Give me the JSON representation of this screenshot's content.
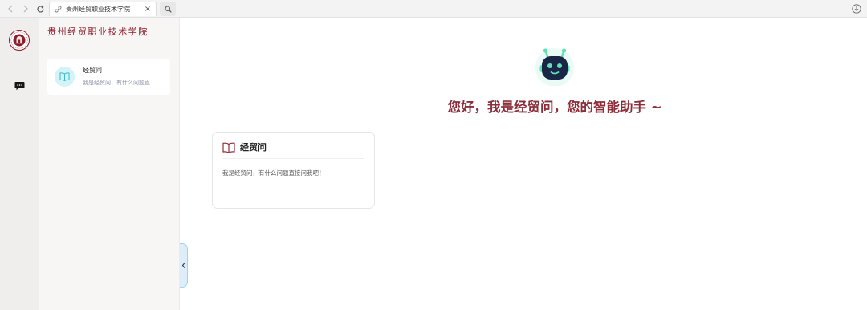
{
  "browser": {
    "tab_title": "贵州经贸职业技术学院",
    "tab_icon": "link-icon",
    "close_symbol": "×"
  },
  "rail": {
    "logo": "school-seal-logo",
    "nav_icon": "chat-bubble-icon"
  },
  "sidebar": {
    "school_name": "贵州经贸职业技术学院",
    "conversations": [
      {
        "title": "经贸问",
        "subtitle": "我是经贸问，有什么问题直...",
        "icon": "book-icon"
      }
    ]
  },
  "main": {
    "greeting": "您好，我是经贸问，您的智能助手 ~",
    "card": {
      "title": "经贸问",
      "description": "我是经贸问，有什么问题直接问我吧！"
    }
  },
  "colors": {
    "brand": "#8b1e2c",
    "greeting": "#8b2e3a",
    "robot_accent": "#5fe0b8",
    "robot_face": "#1a2646",
    "avatar_bg": "#d2f3f8",
    "handle_bg": "#ddeefa"
  }
}
